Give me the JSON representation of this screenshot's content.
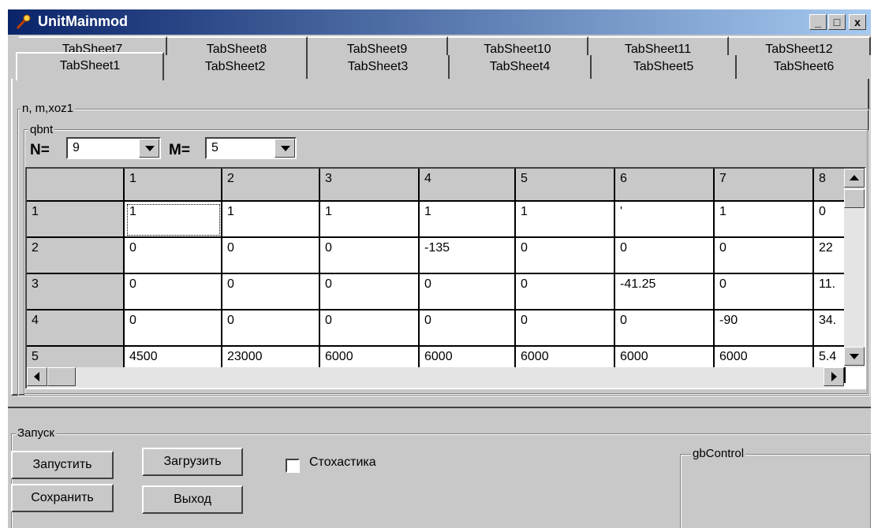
{
  "window": {
    "title": "UnitMainmod",
    "min": "_",
    "max": "□",
    "close": "x"
  },
  "tabs_back": [
    "TabSheet7",
    "TabSheet8",
    "TabSheet9",
    "TabSheet10",
    "TabSheet11",
    "TabSheet12"
  ],
  "tabs_front": [
    "TabSheet1",
    "TabSheet2",
    "TabSheet3",
    "TabSheet4",
    "TabSheet5",
    "TabSheet6"
  ],
  "selected_tab": "TabSheet1",
  "groups": {
    "outer": "n, m,xoz1",
    "inner": "qbnt",
    "launch": "Запуск",
    "control": "gbControl"
  },
  "params": {
    "n_label": "N=",
    "n_value": "9",
    "m_label": "M=",
    "m_value": "5"
  },
  "grid": {
    "col_headers": [
      "",
      "1",
      "2",
      "3",
      "4",
      "5",
      "6",
      "7",
      "8"
    ],
    "rows": [
      [
        "1",
        "1",
        "1",
        "1",
        "1",
        "1",
        "'",
        "1",
        "0"
      ],
      [
        "2",
        "0",
        "0",
        "0",
        "-135",
        "0",
        "0",
        "0",
        "22"
      ],
      [
        "3",
        "0",
        "0",
        "0",
        "0",
        "0",
        "-41.25",
        "0",
        "11."
      ],
      [
        "4",
        "0",
        "0",
        "0",
        "0",
        "0",
        "0",
        "-90",
        "34."
      ],
      [
        "5",
        "4500",
        "23000",
        "6000",
        "6000",
        "6000",
        "6000",
        "6000",
        "5.4"
      ]
    ]
  },
  "buttons": {
    "run": "Запустить",
    "load": "Загрузить",
    "save": "Сохранить",
    "exit": "Выход"
  },
  "stochastic": {
    "label": "Стохастика",
    "checked": false
  }
}
